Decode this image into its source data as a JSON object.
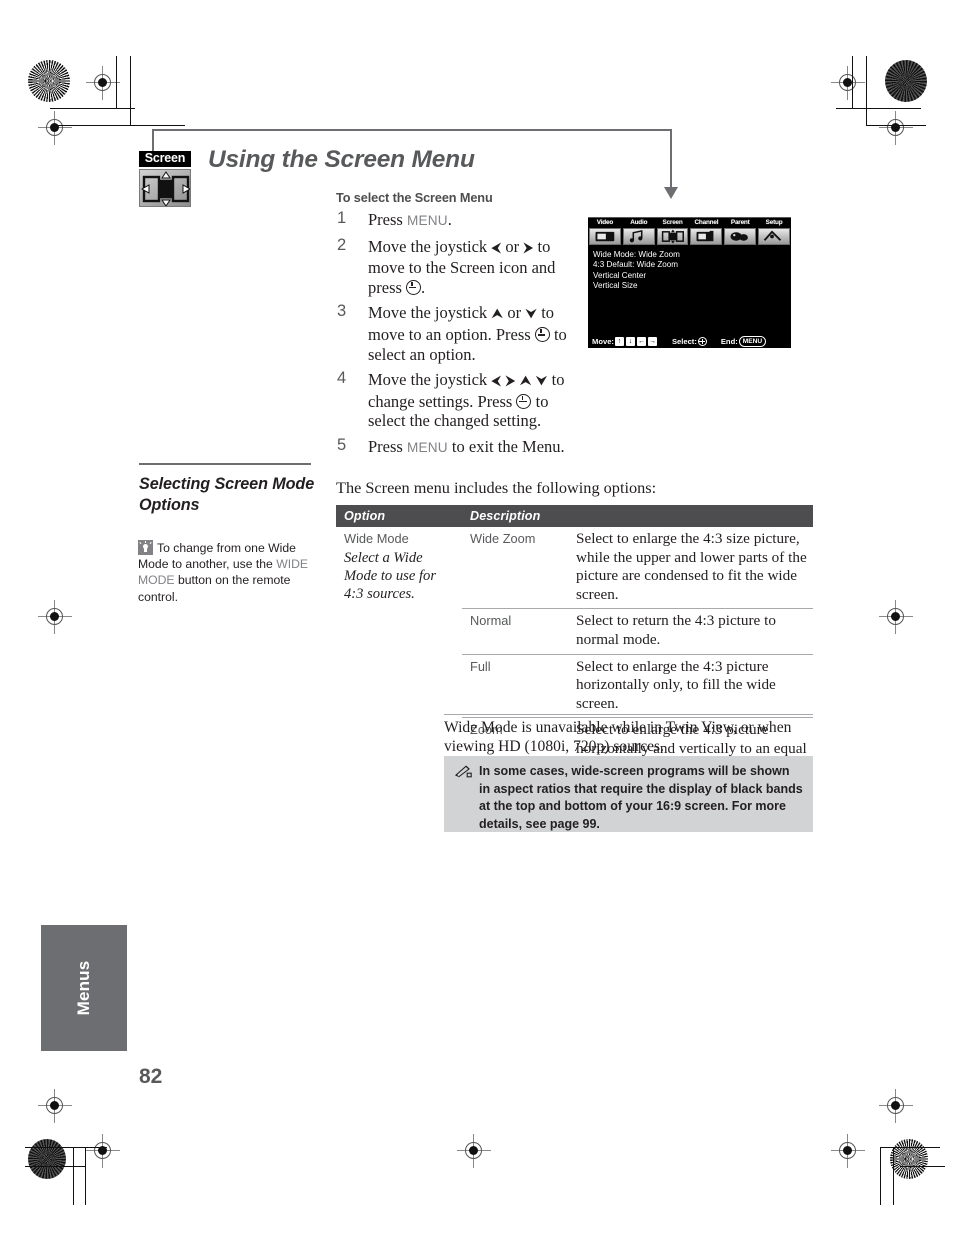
{
  "page": {
    "folio": "82",
    "side_tab": "Menus"
  },
  "header": {
    "icon_label": "Screen",
    "title": "Using the Screen Menu"
  },
  "procedure": {
    "subhead": "To select the Screen Menu",
    "steps": [
      {
        "num": "1",
        "parts": [
          {
            "t": "text",
            "v": "Press "
          },
          {
            "t": "kbd",
            "v": "MENU"
          },
          {
            "t": "text",
            "v": "."
          }
        ]
      },
      {
        "num": "2",
        "parts": [
          {
            "t": "text",
            "v": "Move the joystick "
          },
          {
            "t": "arrow",
            "v": "⮜"
          },
          {
            "t": "text",
            "v": " or "
          },
          {
            "t": "arrow",
            "v": "⮞"
          },
          {
            "t": "text",
            "v": " to move to the Screen icon and press "
          },
          {
            "t": "enter",
            "v": ""
          },
          {
            "t": "text",
            "v": "."
          }
        ]
      },
      {
        "num": "3",
        "parts": [
          {
            "t": "text",
            "v": "Move the joystick "
          },
          {
            "t": "arrow",
            "v": "⮝"
          },
          {
            "t": "text",
            "v": " or "
          },
          {
            "t": "arrow",
            "v": "⮟"
          },
          {
            "t": "text",
            "v": " to move to an option. Press "
          },
          {
            "t": "enter",
            "v": ""
          },
          {
            "t": "text",
            "v": " to select an option."
          }
        ]
      },
      {
        "num": "4",
        "parts": [
          {
            "t": "text",
            "v": "Move the joystick "
          },
          {
            "t": "arrow",
            "v": "⮜"
          },
          {
            "t": "text",
            "v": " "
          },
          {
            "t": "arrow",
            "v": "⮞"
          },
          {
            "t": "text",
            "v": "  "
          },
          {
            "t": "arrow",
            "v": "⮝"
          },
          {
            "t": "text",
            "v": " "
          },
          {
            "t": "arrow",
            "v": "⮟"
          },
          {
            "t": "text",
            "v": " to change settings. Press "
          },
          {
            "t": "enter",
            "v": ""
          },
          {
            "t": "text",
            "v": " to select the changed setting."
          }
        ]
      },
      {
        "num": "5",
        "parts": [
          {
            "t": "text",
            "v": "Press "
          },
          {
            "t": "kbd",
            "v": "MENU"
          },
          {
            "t": "text",
            "v": " to exit the Menu."
          }
        ]
      }
    ]
  },
  "tv_menu": {
    "tabs": [
      {
        "label": "Video",
        "icon": "video-icon",
        "selected": false
      },
      {
        "label": "Audio",
        "icon": "audio-icon",
        "selected": false
      },
      {
        "label": "Screen",
        "icon": "screen-icon",
        "selected": true
      },
      {
        "label": "Channel",
        "icon": "channel-icon",
        "selected": false
      },
      {
        "label": "Parent",
        "icon": "parent-icon",
        "selected": false
      },
      {
        "label": "Setup",
        "icon": "setup-icon",
        "selected": false
      }
    ],
    "items": [
      "Wide Mode: Wide Zoom",
      "4:3 Default: Wide Zoom",
      "Vertical Center",
      "Vertical Size"
    ],
    "footer": {
      "move_label": "Move:",
      "move_keys": [
        "↑",
        "↓",
        "←",
        "→"
      ],
      "select_label": "Select:",
      "end_label": "End:",
      "end_key": "MENU"
    }
  },
  "section": {
    "title": "Selecting Screen Mode Options",
    "tip": {
      "before": "To change from one Wide Mode to another, use the ",
      "highlight": "WIDE MODE",
      "after": " button on the remote control."
    }
  },
  "options": {
    "intro": "The Screen menu includes the following options:",
    "columns": [
      "Option",
      "Description"
    ],
    "option_name": "Wide Mode",
    "option_desc": "Select a Wide Mode to use for 4:3 sources.",
    "rows": [
      {
        "mode": "Wide Zoom",
        "description": "Select to enlarge the 4:3 size picture, while the upper and lower parts of the picture are condensed to fit the wide screen."
      },
      {
        "mode": "Normal",
        "description": "Select to return the 4:3 picture to normal mode."
      },
      {
        "mode": "Full",
        "description": "Select to enlarge the 4:3 picture horizontally only, to fill the wide screen."
      },
      {
        "mode": "Zoom",
        "description": "Select to enlarge the 4:3 picture horizontally and vertically to an equal aspect ratio that fills the wide screen."
      }
    ],
    "after_note": "Wide Mode is unavailable while in Twin View, or when viewing HD (1080i, 720p) sources.",
    "callout_note": "In some cases, wide-screen programs will be shown in aspect ratios that require the display of black bands at the top and bottom of your 16:9 screen. For more details, see page 99."
  },
  "colors": {
    "title_gray": "#58595b",
    "table_header_bg": "#4d4d4f",
    "note_bg": "#d1d3d4",
    "tab_bg": "#6d6e71",
    "accent_gray": "#808285"
  }
}
